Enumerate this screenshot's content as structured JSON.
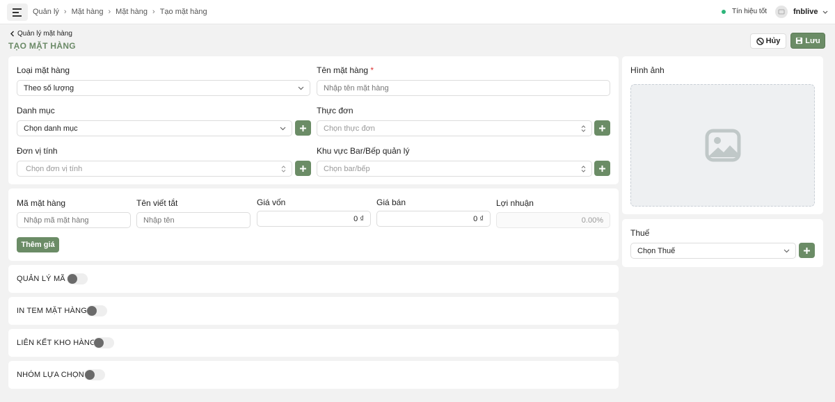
{
  "topbar": {
    "breadcrumb": [
      "Quản lý",
      "Mặt hàng",
      "Mặt hàng",
      "Tạo mặt hàng"
    ],
    "signal_label": "Tín hiệu tốt",
    "signal_color": "#2db57a",
    "username": "fnblive"
  },
  "header": {
    "back_label": "Quản lý mặt hàng",
    "title": "TẠO MẶT HÀNG",
    "cancel_label": "Hủy",
    "save_label": "Lưu"
  },
  "general": {
    "item_type_label": "Loại mặt hàng",
    "item_type_value": "Theo số lượng",
    "item_name_label": "Tên mặt hàng",
    "item_name_required": "*",
    "item_name_placeholder": "Nhập tên mặt hàng",
    "category_label": "Danh mục",
    "category_value": "Chọn danh mục",
    "menu_label": "Thực đơn",
    "menu_placeholder": "Chọn thực đơn",
    "unit_label": "Đơn vị tính",
    "unit_placeholder": "Chọn đơn vị tính",
    "area_label": "Khu vực Bar/Bếp quản lý",
    "area_placeholder": "Chọn bar/bếp"
  },
  "pricing": {
    "code_label": "Mã mặt hàng",
    "code_placeholder": "Nhập mã mặt hàng",
    "short_name_label": "Tên viết tắt",
    "short_name_placeholder": "Nhập tên",
    "cost_label": "Giá vốn",
    "cost_value": "0 ₫",
    "price_label": "Giá bán",
    "price_value": "0 ₫",
    "profit_label": "Lợi nhuận",
    "profit_value": "0.00%",
    "add_price_label": "Thêm giá"
  },
  "toggles": [
    {
      "label": "QUẢN LÝ MÃ",
      "on": false
    },
    {
      "label": "IN TEM MẶT HÀNG",
      "on": false
    },
    {
      "label": "LIÊN KẾT KHO HÀNG",
      "on": false
    },
    {
      "label": "NHÓM LỰA CHỌN",
      "on": false
    }
  ],
  "sidebar": {
    "image_label": "Hình ảnh",
    "tax_label": "Thuế",
    "tax_value": "Chọn Thuế"
  },
  "colors": {
    "accent": "#6b8c66",
    "title": "#6b8a67",
    "required": "#d33333"
  },
  "icons": [
    "menu-icon",
    "chevron-right-icon",
    "avatar-icon",
    "chevron-down-icon",
    "chevron-left-icon",
    "ban-icon",
    "save-icon",
    "chevron-updown-icon",
    "plus-icon",
    "image-placeholder-icon"
  ]
}
